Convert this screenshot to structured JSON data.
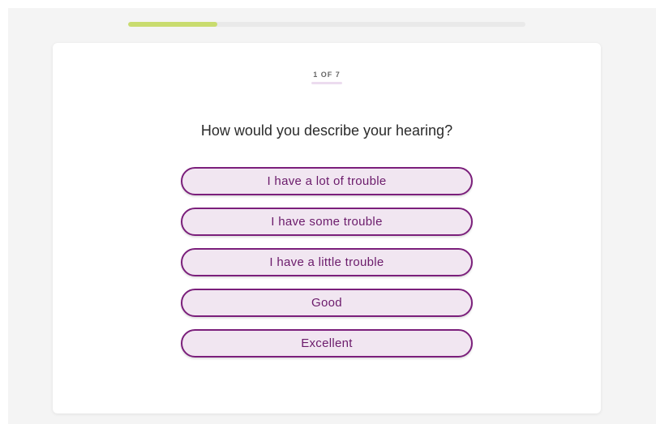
{
  "progress": {
    "fraction": 0.2245,
    "fill_color": "#c9dc6f",
    "track_color": "#e9e9e9"
  },
  "step": {
    "label": "1 OF 7"
  },
  "question": {
    "text": "How would you describe your hearing?"
  },
  "options": [
    {
      "label": "I have a lot of trouble"
    },
    {
      "label": "I have some trouble"
    },
    {
      "label": "I have a little trouble"
    },
    {
      "label": "Good"
    },
    {
      "label": "Excellent"
    }
  ],
  "colors": {
    "accent": "#7b1f7b",
    "option_bg": "#f1e6f1",
    "background": "#f4f4f4"
  }
}
